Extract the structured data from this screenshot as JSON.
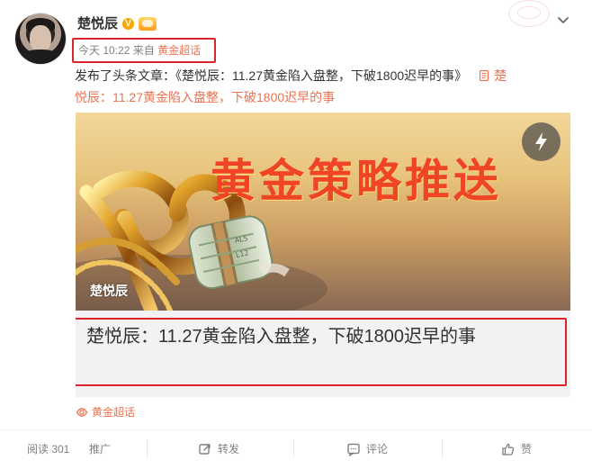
{
  "post": {
    "author": "楚悦辰",
    "meta": {
      "time": "今天 10:22",
      "from_label": "来自",
      "source": "黄金超话"
    },
    "text": {
      "prefix": "发布了头条文章：《楚悦辰：11.27黄金陷入盘整，下破1800迟早的事》",
      "link_first": "楚",
      "link_rest": "悦辰：11.27黄金陷入盘整，下破1800迟早的事"
    },
    "card": {
      "banner_text": "黄金策略推送",
      "banner_logo": "楚悦辰",
      "title": "楚悦辰：11.27黄金陷入盘整，下破1800迟早的事"
    },
    "topic": "黄金超话"
  },
  "actions": {
    "read": "阅读 301",
    "promote": "推广",
    "repost": "转发",
    "comment": "评论",
    "like": "赞"
  },
  "colors": {
    "accent": "#eb7350",
    "highlight_border": "#d8242a",
    "muted": "#808080",
    "card_bg": "#f2f2f5"
  },
  "icons": {
    "verified": "verified-icon",
    "crown": "crown-icon",
    "chevron": "chevron-down-icon",
    "document": "document-icon",
    "flash": "flash-icon",
    "topic": "topic-icon",
    "repost": "repost-icon",
    "comment": "comment-icon",
    "like": "like-icon"
  }
}
